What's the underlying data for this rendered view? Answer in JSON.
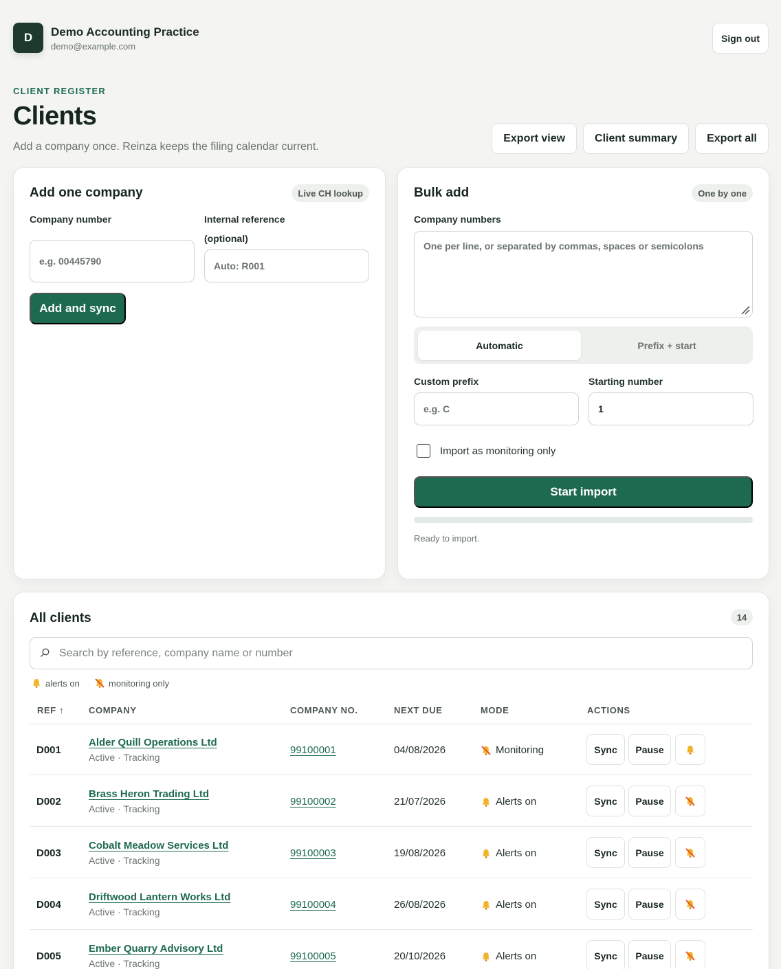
{
  "header": {
    "avatar_letter": "D",
    "practice_name": "Demo Accounting Practice",
    "email": "demo@example.com",
    "sign_out": "Sign out"
  },
  "page": {
    "eyebrow": "CLIENT REGISTER",
    "title": "Clients",
    "subtitle": "Add a company once. Reinza keeps the filing calendar current.",
    "actions": [
      "Export view",
      "Client summary",
      "Export all"
    ]
  },
  "add_one": {
    "title": "Add one company",
    "badge": "Live CH lookup",
    "company_number_label": "Company number",
    "company_number_placeholder": "e.g. 00445790",
    "internal_ref_label": "Internal reference",
    "internal_ref_optional": "(optional)",
    "internal_ref_placeholder": "Auto: R001",
    "submit": "Add and sync"
  },
  "bulk_add": {
    "title": "Bulk add",
    "badge": "One by one",
    "numbers_label": "Company numbers",
    "numbers_placeholder": "One per line, or separated by commas, spaces or semicolons",
    "modes": [
      "Automatic",
      "Prefix + start"
    ],
    "active_mode": "Automatic",
    "prefix_label": "Custom prefix",
    "prefix_placeholder": "e.g. C",
    "start_label": "Starting number",
    "start_value": "1",
    "monitoring_only_label": "Import as monitoring only",
    "monitoring_only_checked": false,
    "submit": "Start import",
    "progress": 0,
    "status": "Ready to import."
  },
  "clients": {
    "title": "All clients",
    "count": "14",
    "search_placeholder": "Search by reference, company name or number",
    "legend_alerts": "alerts on",
    "legend_monitoring": "monitoring only",
    "columns": [
      "REF ↑",
      "COMPANY",
      "COMPANY NO.",
      "NEXT DUE",
      "MODE",
      "ACTIONS"
    ],
    "sync_label": "Sync",
    "pause_label": "Pause",
    "rows": [
      {
        "ref": "D001",
        "company": "Alder Quill Operations Ltd",
        "status": "Active · Tracking",
        "number": "99100001",
        "next_due": "04/08/2026",
        "mode": "Monitoring",
        "mode_icon": "bell-off-icon",
        "action_icon": "bell-icon"
      },
      {
        "ref": "D002",
        "company": "Brass Heron Trading Ltd",
        "status": "Active · Tracking",
        "number": "99100002",
        "next_due": "21/07/2026",
        "mode": "Alerts on",
        "mode_icon": "bell-icon",
        "action_icon": "bell-off-icon"
      },
      {
        "ref": "D003",
        "company": "Cobalt Meadow Services Ltd",
        "status": "Active · Tracking",
        "number": "99100003",
        "next_due": "19/08/2026",
        "mode": "Alerts on",
        "mode_icon": "bell-icon",
        "action_icon": "bell-off-icon"
      },
      {
        "ref": "D004",
        "company": "Driftwood Lantern Works Ltd",
        "status": "Active · Tracking",
        "number": "99100004",
        "next_due": "26/08/2026",
        "mode": "Alerts on",
        "mode_icon": "bell-icon",
        "action_icon": "bell-off-icon"
      },
      {
        "ref": "D005",
        "company": "Ember Quarry Advisory Ltd",
        "status": "Active · Tracking",
        "number": "99100005",
        "next_due": "20/10/2026",
        "mode": "Alerts on",
        "mode_icon": "bell-icon",
        "action_icon": "bell-off-icon"
      }
    ]
  },
  "colors": {
    "brand": "#1e6a51",
    "avatar": "#1e3a2e",
    "bell": "#f0b429",
    "bell_off_slash": "#e8572a"
  }
}
